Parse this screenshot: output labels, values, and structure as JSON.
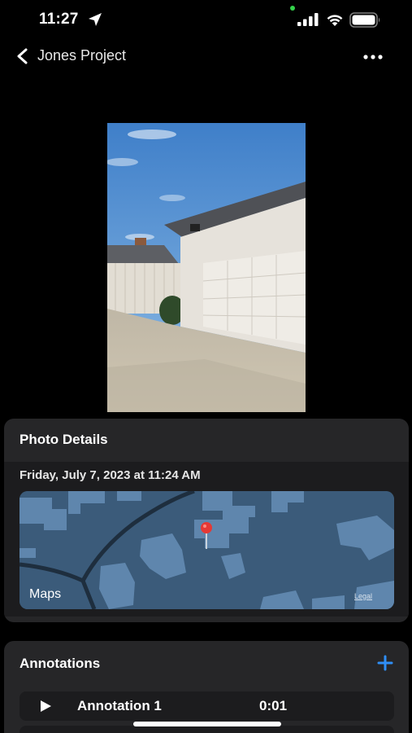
{
  "status_bar": {
    "time": "11:27",
    "icons": [
      "location-arrow-icon",
      "cellular-signal-icon",
      "wifi-icon",
      "battery-icon"
    ]
  },
  "nav": {
    "back_icon": "chevron-left-icon",
    "title": "Jones Project",
    "more_icon": "ellipsis-icon"
  },
  "photo": {
    "subject": "house garage driveway"
  },
  "photo_details": {
    "title": "Photo Details",
    "date": "Friday, July 7, 2023 at 11:24 AM",
    "map_brand": "Maps",
    "map_legal": "Legal",
    "pin_color": "#e53935"
  },
  "annotations": {
    "title": "Annotations",
    "add_icon": "plus-icon",
    "accent_color": "#2f8ff7",
    "items": [
      {
        "name": "Annotation 1",
        "duration": "0:01"
      }
    ]
  }
}
